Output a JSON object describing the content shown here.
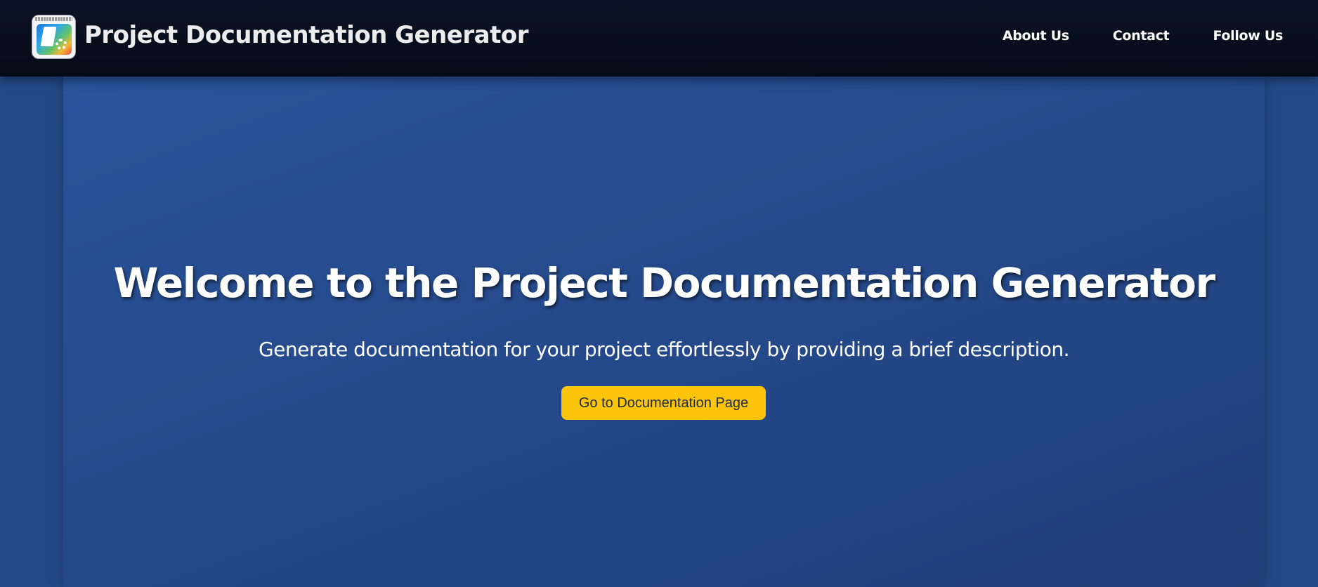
{
  "header": {
    "logo_icon": "documentation-gear-logo",
    "brand_title": "Project Documentation Generator",
    "nav": [
      {
        "label": "About Us"
      },
      {
        "label": "Contact"
      },
      {
        "label": "Follow Us"
      }
    ]
  },
  "hero": {
    "title": "Welcome to the Project Documentation Generator",
    "subtitle": "Generate documentation for your project effortlessly by providing a brief description.",
    "cta_label": "Go to Documentation Page"
  },
  "colors": {
    "header_bg": "#060b17",
    "hero_bg": "#254a8c",
    "accent": "#fcc40a",
    "text": "#ffffff"
  }
}
